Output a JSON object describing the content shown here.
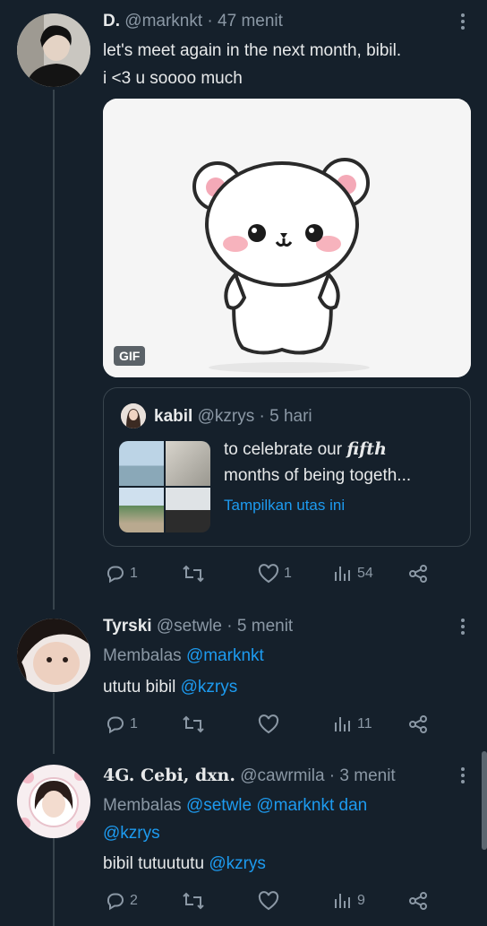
{
  "tweets": [
    {
      "name": "D.",
      "handle": "@marknkt",
      "sep": "·",
      "time": "47 menit",
      "text_line1": "let's meet again in the next month, bibil.",
      "text_line2": "i <3 u soooo much",
      "media": {
        "badge": "GIF"
      },
      "quote": {
        "name": "kabil",
        "handle": "@kzrys",
        "sep": "·",
        "time": "5 hari",
        "text_pre": "to celebrate our ",
        "text_em": "fifth",
        "text_line2": "months of being togeth...",
        "show_thread": "Tampilkan utas ini"
      },
      "counts": {
        "reply": "1",
        "retweet": "",
        "like": "1",
        "views": "54"
      }
    },
    {
      "name": "Tyrski",
      "handle": "@setwle",
      "sep": "·",
      "time": "5 menit",
      "reply_prefix": "Membalas",
      "reply_to": "@marknkt",
      "text": "ututu bibil",
      "mention": "@kzrys",
      "counts": {
        "reply": "1",
        "retweet": "",
        "like": "",
        "views": "11"
      }
    },
    {
      "name": "4G. Cebi, dxn.",
      "handle": "@cawrmila",
      "sep": "·",
      "time": "3 menit",
      "reply_prefix": "Membalas",
      "reply_to_1": "@setwle",
      "reply_to_2": "@marknkt",
      "reply_and": "dan",
      "reply_to_3": "@kzrys",
      "text": "bibil tutuututu",
      "mention": "@kzrys",
      "counts": {
        "reply": "2",
        "retweet": "",
        "like": "",
        "views": "9"
      }
    }
  ],
  "icons": {
    "reply": "reply-icon",
    "retweet": "retweet-icon",
    "like": "heart-icon",
    "views": "analytics-icon",
    "share": "share-icon",
    "more": "more-icon"
  },
  "colors": {
    "background": "#15202b",
    "text": "#e7e9ea",
    "muted": "#8b98a5",
    "accent": "#1d9bf0",
    "border": "#38444d"
  }
}
